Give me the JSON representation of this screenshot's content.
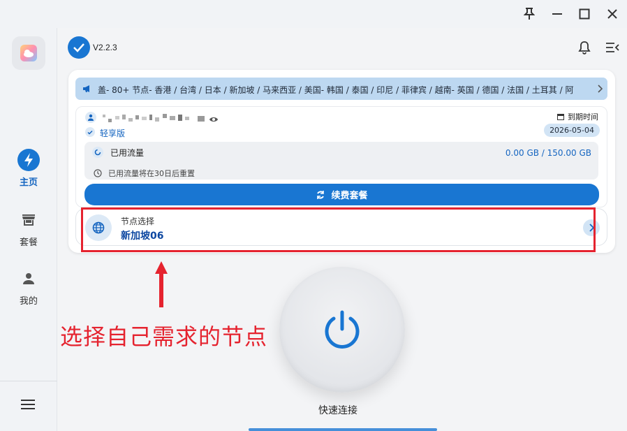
{
  "window": {
    "pin_icon": "pin-icon",
    "minimize_icon": "minimize-icon",
    "maximize_icon": "maximize-icon",
    "close_icon": "close-icon"
  },
  "sidebar": {
    "items": [
      {
        "label": "主页",
        "icon": "flash-icon",
        "active": true
      },
      {
        "label": "套餐",
        "icon": "store-icon",
        "active": false
      },
      {
        "label": "我的",
        "icon": "person-icon",
        "active": false
      }
    ],
    "menu_icon": "menu-icon"
  },
  "header": {
    "version": "V2.2.3"
  },
  "notice": {
    "text": "盖- 80+ 节点- 香港 / 台湾 / 日本 / 新加坡 / 马来西亚 / 美国- 韩国 / 泰国 / 印尼 / 菲律宾 / 越南- 英国 / 德国 / 法国 / 土耳其 / 阿"
  },
  "account": {
    "plan": "轻享版",
    "expiry_label": "到期时间",
    "expiry_date": "2026-05-04",
    "traffic_label": "已用流量",
    "traffic_value": "0.00 GB / 150.00 GB",
    "reset_note": "已用流量将在30日后重置",
    "renew_label": "续费套餐"
  },
  "node": {
    "title": "节点选择",
    "value": "新加坡06"
  },
  "annotation": {
    "text": "选择自己需求的节点"
  },
  "connect": {
    "label": "快速连接"
  },
  "colors": {
    "accent": "#1976d2",
    "annotation_red": "#e5232f"
  }
}
